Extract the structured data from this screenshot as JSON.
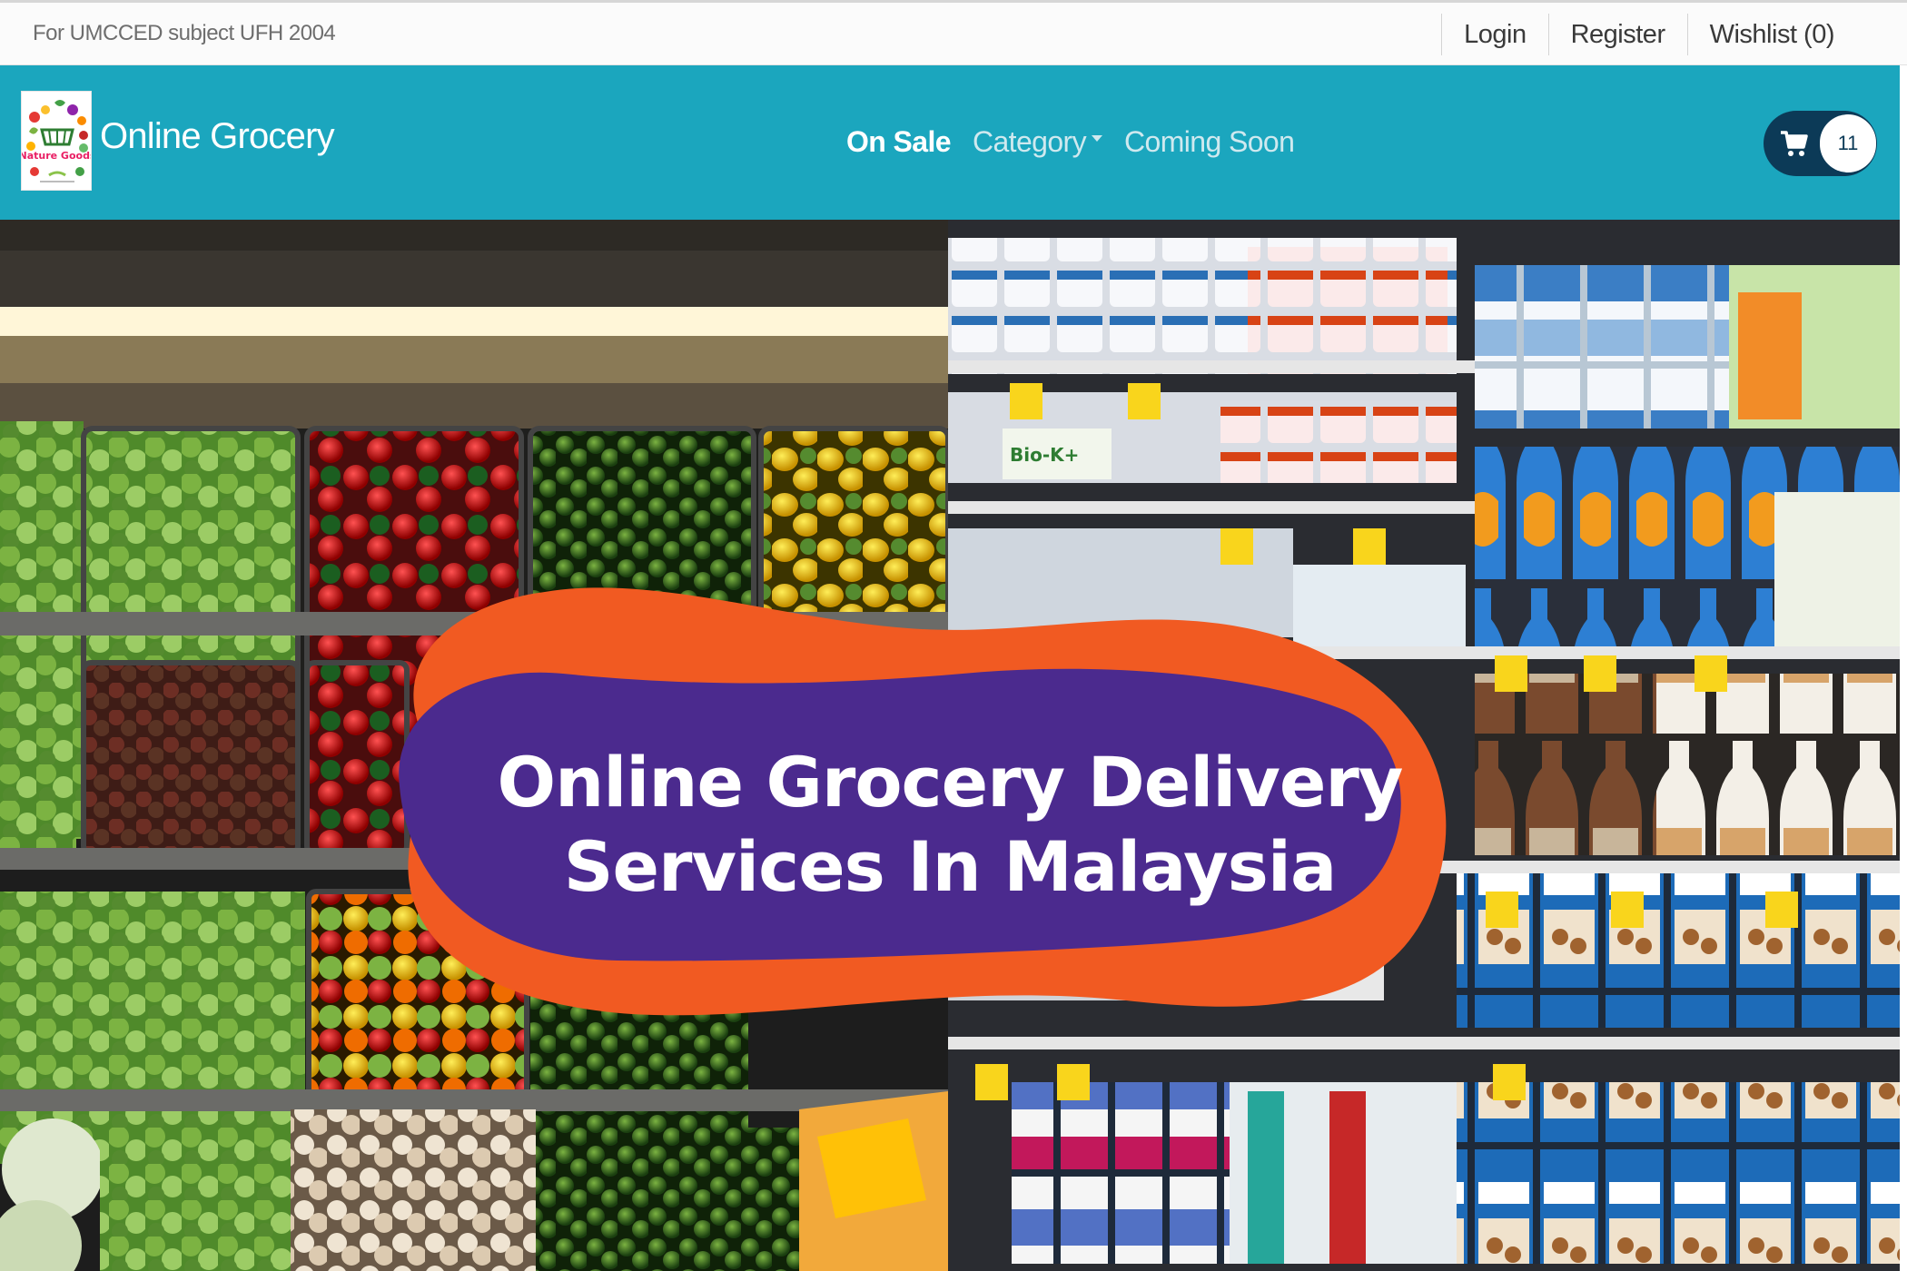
{
  "topbar": {
    "note": "For UMCCED subject UFH 2004",
    "links": {
      "login": "Login",
      "register": "Register",
      "wishlist": "Wishlist (0)"
    }
  },
  "navbar": {
    "logo_text": "Nature Goods",
    "brand": "Online Grocery",
    "menu": {
      "on_sale": "On Sale",
      "category": "Category",
      "coming_soon": "Coming Soon"
    },
    "cart_count": "11"
  },
  "hero": {
    "line1": "Online Grocery Delivery",
    "line2": "Services In Malaysia"
  },
  "colors": {
    "navbar": "#1ba6be",
    "cart_button": "#0c3a57",
    "banner_purple": "#4b2a8e",
    "banner_orange": "#f15a22"
  },
  "icons": {
    "cart": "shopping-cart-icon",
    "caret": "chevron-down-icon"
  }
}
